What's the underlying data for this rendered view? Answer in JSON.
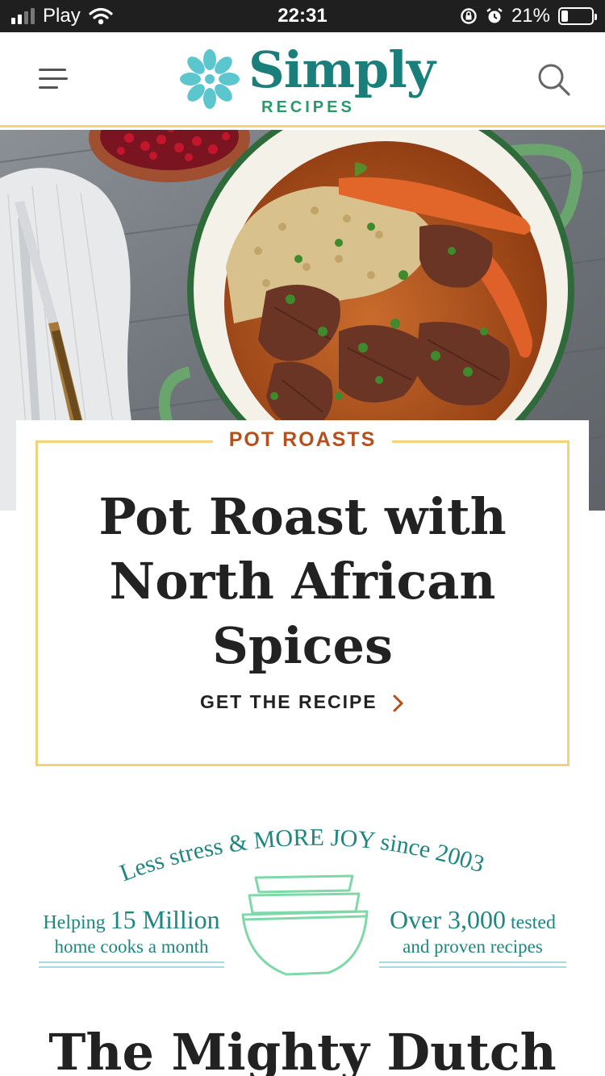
{
  "status_bar": {
    "carrier": "Play",
    "time": "22:31",
    "battery_percent": "21%",
    "battery_level": 0.21,
    "icons": [
      "signal-icon",
      "wifi-icon",
      "rotation-lock-icon",
      "alarm-icon",
      "battery-icon"
    ]
  },
  "header": {
    "logo_word": "Simply",
    "logo_sub": "RECIPES",
    "icons": [
      "menu-icon",
      "flower-logo-icon",
      "search-icon"
    ]
  },
  "featured": {
    "category": "POT ROASTS",
    "title": "Pot Roast with North African Spices",
    "cta": "GET THE RECIPE"
  },
  "promo": {
    "arc_text": "Less stress & MORE JOY since 2003",
    "left_prefix": "Helping ",
    "left_big": "15 Million",
    "left_line2": "home cooks a month",
    "right_big": "Over 3,000",
    "right_suffix": " tested",
    "right_line2": "and proven recipes"
  },
  "next_section": {
    "title": "The Mighty Dutch"
  },
  "colors": {
    "brand_teal": "#1a7f7a",
    "brand_green": "#2a9a6a",
    "logo_flower": "#5cc6cf",
    "accent_rust": "#b3501e",
    "frame_yellow": "#f0d47a",
    "bowl_green": "#7ed8a8",
    "rule_blue": "#a8dbe0"
  }
}
